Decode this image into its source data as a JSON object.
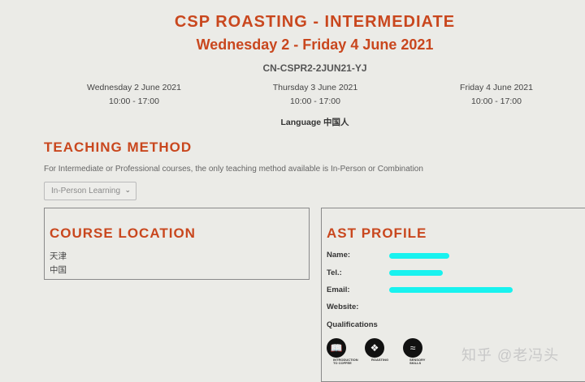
{
  "course": {
    "title": "CSP ROASTING - INTERMEDIATE",
    "dates": "Wednesday 2 - Friday 4 June 2021",
    "code": "CN-CSPR2-2JUN21-YJ",
    "days": [
      {
        "date": "Wednesday 2 June 2021",
        "time": "10:00 - 17:00"
      },
      {
        "date": "Thursday 3 June 2021",
        "time": "10:00 - 17:00"
      },
      {
        "date": "Friday 4 June 2021",
        "time": "10:00 - 17:00"
      }
    ],
    "language": "Language 中国人"
  },
  "teaching": {
    "heading": "TEACHING METHOD",
    "note": "For Intermediate or Professional courses, the only teaching method available is In-Person or Combination",
    "selected": "In-Person Learning"
  },
  "location": {
    "heading": "COURSE LOCATION",
    "city": "天津",
    "country": "中国"
  },
  "ast": {
    "heading": "AST PROFILE",
    "name_label": "Name:",
    "tel_label": "Tel.:",
    "email_label": "Email:",
    "website_label": "Website:",
    "qualifications_label": "Qualifications",
    "badges": [
      {
        "icon": "book-icon",
        "caption_line1": "INTRODUCTION",
        "caption_line2": "TO COFFEE"
      },
      {
        "icon": "flame-icon",
        "caption_line1": "ROASTING",
        "caption_line2": ""
      },
      {
        "icon": "aroma-icon",
        "caption_line1": "SENSORY",
        "caption_line2": "SKILLS"
      }
    ],
    "redaction_color": "#18f2ef"
  },
  "watermark": "知乎 @老冯头",
  "colors": {
    "accent": "#c9471e",
    "background": "#ebebe7"
  }
}
